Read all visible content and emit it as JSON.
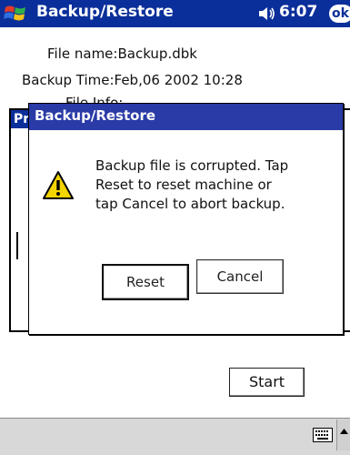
{
  "app": {
    "title": "Backup/Restore",
    "time": "6:07",
    "ok_label": "ok"
  },
  "info": {
    "file_name": "File name:Backup.dbk",
    "backup_time": "Backup Time:Feb,06 2002   10:28",
    "file_info": "File Info:"
  },
  "background": {
    "tab_label": "Pr"
  },
  "dialog": {
    "title": "Backup/Restore",
    "message_line1": "Backup file is corrupted. Tap",
    "message_line2": "Reset to reset machine or",
    "message_line3": "tap Cancel to abort backup.",
    "reset_label": "Reset",
    "cancel_label": "Cancel"
  },
  "main": {
    "start_label": "Start"
  },
  "icons": {
    "start": "windows-flag-icon",
    "volume": "speaker-icon",
    "warning": "warning-icon",
    "keyboard": "keyboard-icon",
    "sip_arrow": "up-arrow-icon"
  },
  "colors": {
    "titlebar": "#0b2f9a",
    "dialog_title": "#2a3aa6",
    "warning": "#f2d400"
  }
}
